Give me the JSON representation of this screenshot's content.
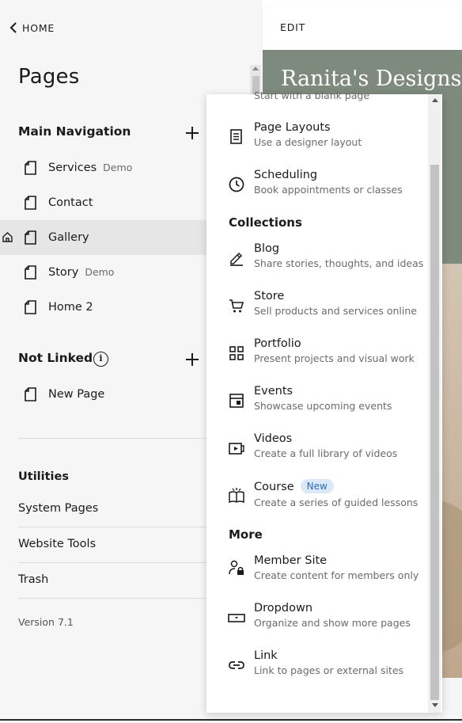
{
  "header": {
    "back_label": "HOME",
    "page_title": "Pages"
  },
  "main_navigation": {
    "title": "Main Navigation",
    "items": [
      {
        "label": "Services",
        "tag": "Demo"
      },
      {
        "label": "Contact",
        "tag": ""
      },
      {
        "label": "Gallery",
        "tag": "",
        "is_homepage": true,
        "active": true
      },
      {
        "label": "Story",
        "tag": "Demo"
      },
      {
        "label": "Home 2",
        "tag": ""
      }
    ]
  },
  "not_linked": {
    "title": "Not Linked",
    "items": [
      {
        "label": "New Page"
      }
    ]
  },
  "utilities": {
    "title": "Utilities",
    "items": [
      "System Pages",
      "Website Tools",
      "Trash"
    ]
  },
  "version": "Version 7.1",
  "preview": {
    "edit_label": "EDIT",
    "site_title": "Ranita's Designs"
  },
  "menu": {
    "truncated_top": "Start with a blank page",
    "layouts": [
      {
        "title": "Page Layouts",
        "desc": "Use a designer layout",
        "icon": "page-layout-icon"
      },
      {
        "title": "Scheduling",
        "desc": "Book appointments or classes",
        "icon": "clock-icon"
      }
    ],
    "collections_title": "Collections",
    "collections": [
      {
        "title": "Blog",
        "desc": "Share stories, thoughts, and ideas",
        "icon": "pen-icon"
      },
      {
        "title": "Store",
        "desc": "Sell products and services online",
        "icon": "cart-icon"
      },
      {
        "title": "Portfolio",
        "desc": "Present projects and visual work",
        "icon": "grid-icon"
      },
      {
        "title": "Events",
        "desc": "Showcase upcoming events",
        "icon": "calendar-icon"
      },
      {
        "title": "Videos",
        "desc": "Create a full library of videos",
        "icon": "video-icon"
      },
      {
        "title": "Course",
        "badge": "New",
        "desc": "Create a series of guided lessons",
        "icon": "book-icon"
      }
    ],
    "more_title": "More",
    "more": [
      {
        "title": "Member Site",
        "desc": "Create content for members only",
        "icon": "member-lock-icon"
      },
      {
        "title": "Dropdown",
        "desc": "Organize and show more pages",
        "icon": "dropdown-icon"
      },
      {
        "title": "Link",
        "desc": "Link to pages or external sites",
        "icon": "link-icon"
      }
    ]
  }
}
